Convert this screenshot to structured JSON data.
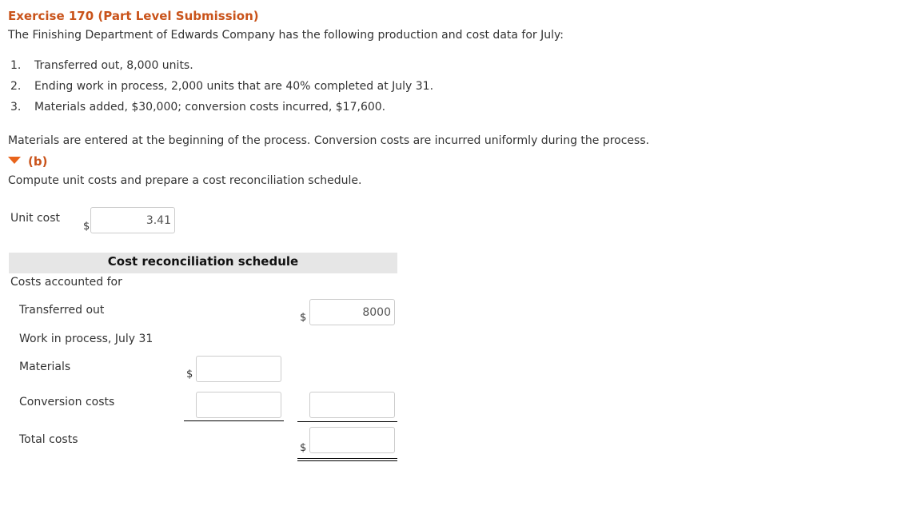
{
  "header": {
    "title": "Exercise 170 (Part Level Submission)",
    "intro": "The Finishing Department of Edwards Company has the following production and cost data for July:"
  },
  "facts": [
    {
      "num": "1.",
      "text": "Transferred out, 8,000 units."
    },
    {
      "num": "2.",
      "text": "Ending work in process, 2,000 units that are 40% completed at July 31."
    },
    {
      "num": "3.",
      "text": "Materials added, $30,000; conversion costs incurred, $17,600."
    }
  ],
  "note": "Materials are entered at the beginning of the process. Conversion costs are incurred uniformly during the process.",
  "part": {
    "label": "(b)",
    "icon": "triangle-down-icon",
    "accent_color": "#e8641c",
    "instruction": "Compute unit costs and prepare a cost reconciliation schedule."
  },
  "unit_cost": {
    "label": "Unit cost",
    "currency": "$",
    "value": "3.41"
  },
  "schedule": {
    "title": "Cost reconciliation schedule",
    "section_label": "Costs accounted for",
    "transferred_out": {
      "label": "Transferred out",
      "currency": "$",
      "value": "8000"
    },
    "wip_label": "Work in process, July 31",
    "materials": {
      "label": "Materials",
      "currency": "$",
      "value": ""
    },
    "conversion": {
      "label": "Conversion costs",
      "value": "",
      "subtotal_value": ""
    },
    "total": {
      "label": "Total costs",
      "currency": "$",
      "value": ""
    }
  }
}
